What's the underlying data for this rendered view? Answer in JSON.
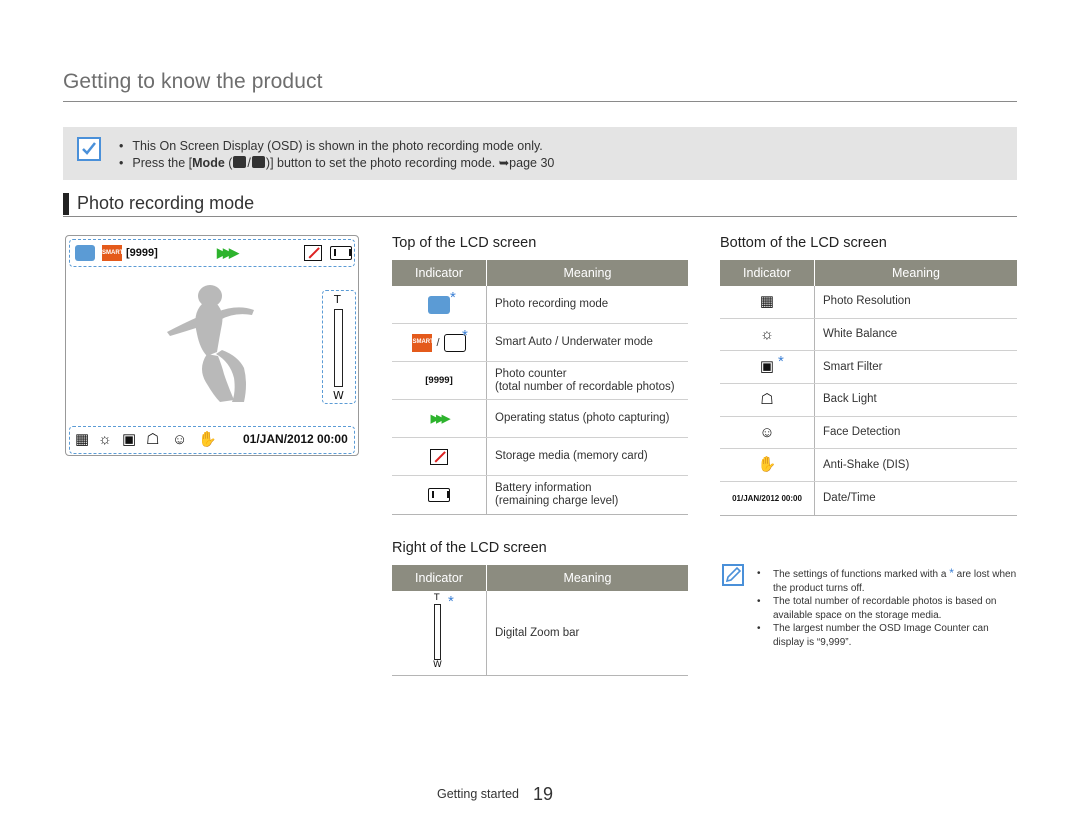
{
  "page": {
    "title": "Getting to know the product",
    "page_number": "19",
    "footer_label": "Getting started"
  },
  "note": {
    "line1": "This On Screen Display (OSD) is shown in the photo recording mode only.",
    "line2_prefix": "Press the [",
    "line2_bold": "Mode",
    "line2_mid": " (",
    "line2_slash": "/",
    "line2_suffix": ")] button to set the photo recording mode. ➥page 30"
  },
  "section": {
    "title": "Photo recording mode"
  },
  "lcd": {
    "counter": "[9999]",
    "date": "01/JAN/2012 00:00",
    "zoom_t": "T",
    "zoom_w": "W",
    "smart_label": "SMART"
  },
  "top_table": {
    "title": "Top of the LCD screen",
    "header_indicator": "Indicator",
    "header_meaning": "Meaning",
    "rows": [
      {
        "icon": "camera-icon",
        "meaning": "Photo recording mode",
        "meaning2": "",
        "starred": true
      },
      {
        "icon": "smart-auto-icon",
        "separator": "/",
        "meaning": "Smart Auto / Underwater mode",
        "meaning2": "",
        "starred": true
      },
      {
        "icon_text": "[9999]",
        "meaning": "Photo counter",
        "meaning2": "(total number of recordable photos)",
        "starred": false
      },
      {
        "icon": "operating-status-icon",
        "meaning": "Operating status (photo capturing)",
        "meaning2": "",
        "starred": false
      },
      {
        "icon": "storage-media-icon",
        "meaning": "Storage media (memory card)",
        "meaning2": "",
        "starred": false
      },
      {
        "icon": "battery-icon",
        "meaning": "Battery information",
        "meaning2": "(remaining charge level)",
        "starred": false
      }
    ]
  },
  "bottom_table": {
    "title": "Bottom of the LCD screen",
    "header_indicator": "Indicator",
    "header_meaning": "Meaning",
    "rows": [
      {
        "icon": "photo-resolution-icon",
        "meaning": "Photo Resolution"
      },
      {
        "icon": "white-balance-icon",
        "meaning": "White Balance"
      },
      {
        "icon": "smart-filter-icon",
        "meaning": "Smart Filter",
        "starred": true
      },
      {
        "icon": "back-light-icon",
        "meaning": "Back Light"
      },
      {
        "icon": "face-detection-icon",
        "meaning": "Face Detection"
      },
      {
        "icon": "anti-shake-icon",
        "meaning": "Anti-Shake (DIS)"
      },
      {
        "icon_text": "01/JAN/2012 00:00",
        "meaning": "Date/Time"
      }
    ]
  },
  "right_table": {
    "title": "Right of the LCD screen",
    "header_indicator": "Indicator",
    "header_meaning": "Meaning",
    "zoom_t": "T",
    "zoom_w": "W",
    "meaning": "Digital Zoom bar"
  },
  "note2": {
    "item1_prefix": "The settings of functions marked with a",
    "item1_suffix": "are lost when the product turns off.",
    "item2": "The total number of recordable photos is based on available space on the storage media.",
    "item3": "The largest number the OSD Image Counter can display is “9,999”."
  },
  "colors": {
    "accent_blue": "#3a7fd5",
    "table_header": "#8c8c80",
    "note_bg": "#e4e4e4",
    "smart_orange": "#e45a1b",
    "status_green": "#2db32d"
  }
}
